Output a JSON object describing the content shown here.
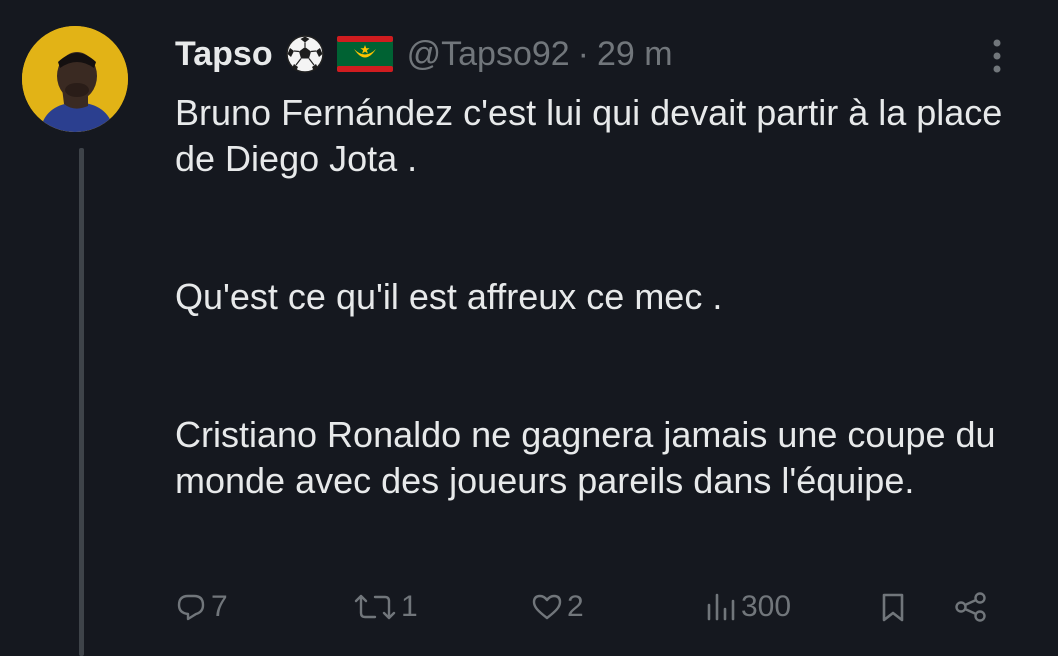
{
  "tweet": {
    "display_name": "Tapso",
    "handle": "@Tapso92",
    "separator": "·",
    "time_ago": "29 m",
    "badges": [
      "soccer-ball-emoji",
      "mauritania-flag-emoji"
    ],
    "paragraphs": [
      "Bruno Fernández c'est lui qui devait partir à la place de Diego Jota .",
      "Qu'est ce qu'il est affreux ce mec .",
      "Cristiano Ronaldo ne gagnera jamais une coupe du monde avec des joueurs pareils dans l'équipe."
    ],
    "stats": {
      "replies": "7",
      "reposts": "1",
      "likes": "2",
      "views": "300"
    }
  },
  "colors": {
    "background": "#15181f",
    "text": "#e7e9ea",
    "muted": "#71767b",
    "thread_line": "#3e4349"
  }
}
